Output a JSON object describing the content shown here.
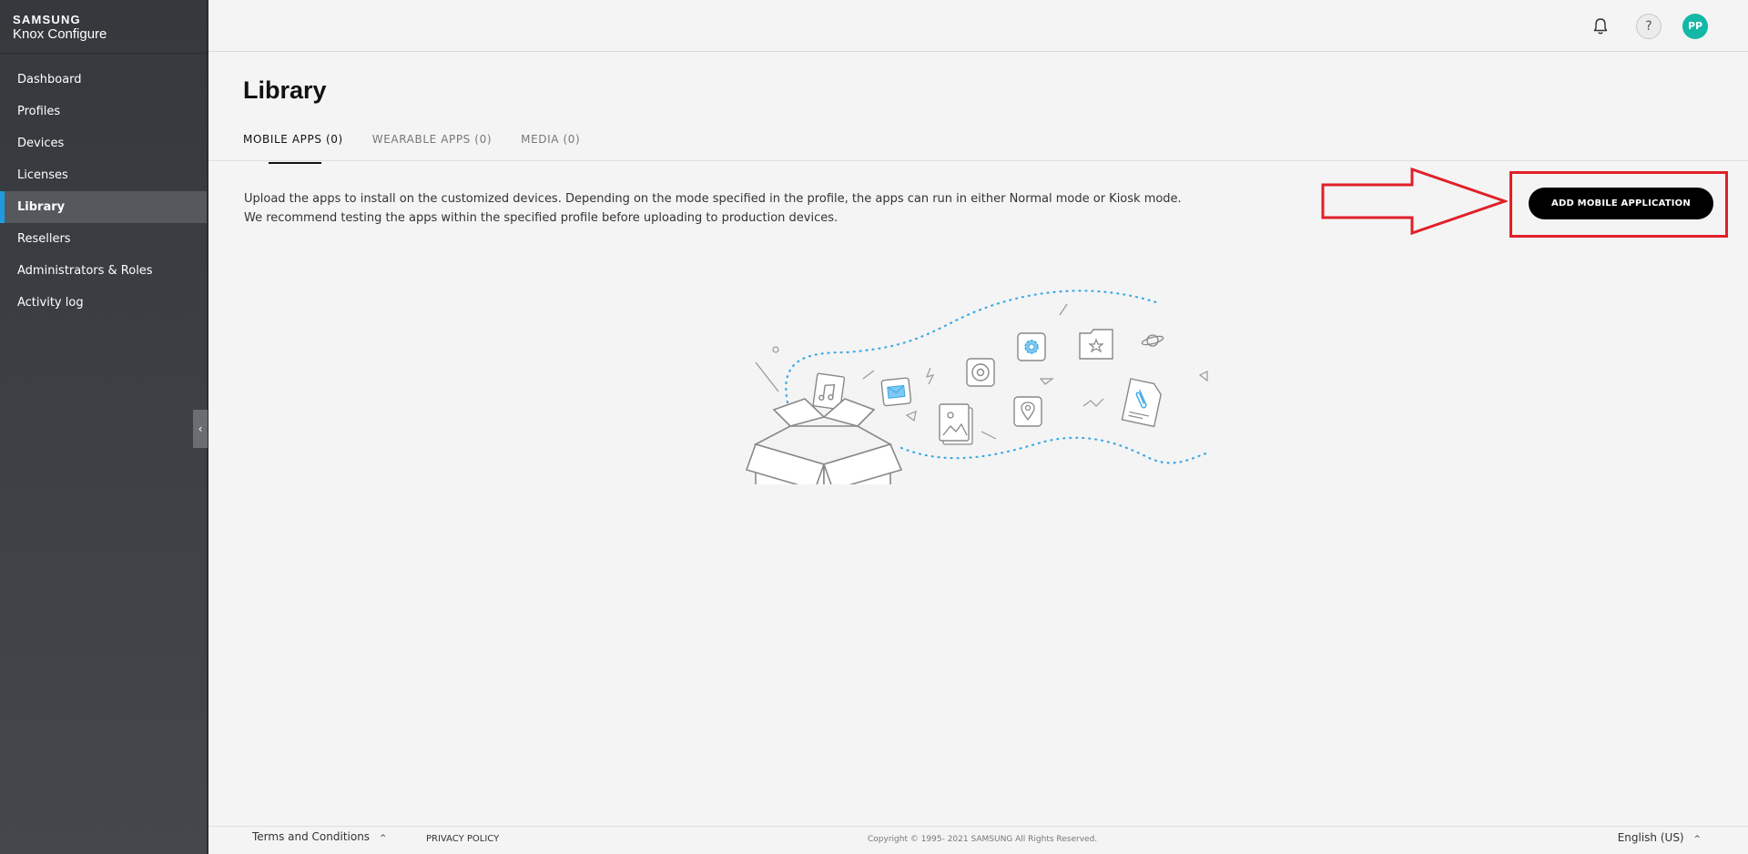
{
  "brand": {
    "line1": "SAMSUNG",
    "line2": "Knox Configure"
  },
  "sidebar": {
    "items": [
      {
        "label": "Dashboard"
      },
      {
        "label": "Profiles"
      },
      {
        "label": "Devices"
      },
      {
        "label": "Licenses"
      },
      {
        "label": "Library",
        "active": true
      },
      {
        "label": "Resellers"
      },
      {
        "label": "Administrators & Roles"
      },
      {
        "label": "Activity log"
      }
    ],
    "collapse_glyph": "‹"
  },
  "header": {
    "help_glyph": "?",
    "avatar_initials": "PP",
    "avatar_color": "#14b8a6"
  },
  "main": {
    "title": "Library",
    "tabs": [
      {
        "label": "MOBILE APPS (0)",
        "active": true
      },
      {
        "label": "WEARABLE APPS (0)"
      },
      {
        "label": "MEDIA (0)"
      }
    ],
    "description_line1": "Upload the apps to install on the customized devices. Depending on the mode specified in the profile, the apps can run in either Normal mode or Kiosk mode.",
    "description_line2": "We recommend testing the apps within the specified profile before uploading to production devices.",
    "add_button_label": "ADD MOBILE APPLICATION",
    "annotation_color": "#e02028"
  },
  "footer": {
    "terms_label": "Terms and Conditions",
    "privacy_label": "PRIVACY POLICY",
    "copyright": "Copyright © 1995- 2021 SAMSUNG All Rights Reserved.",
    "language": "English (US)",
    "chevron": "^"
  }
}
